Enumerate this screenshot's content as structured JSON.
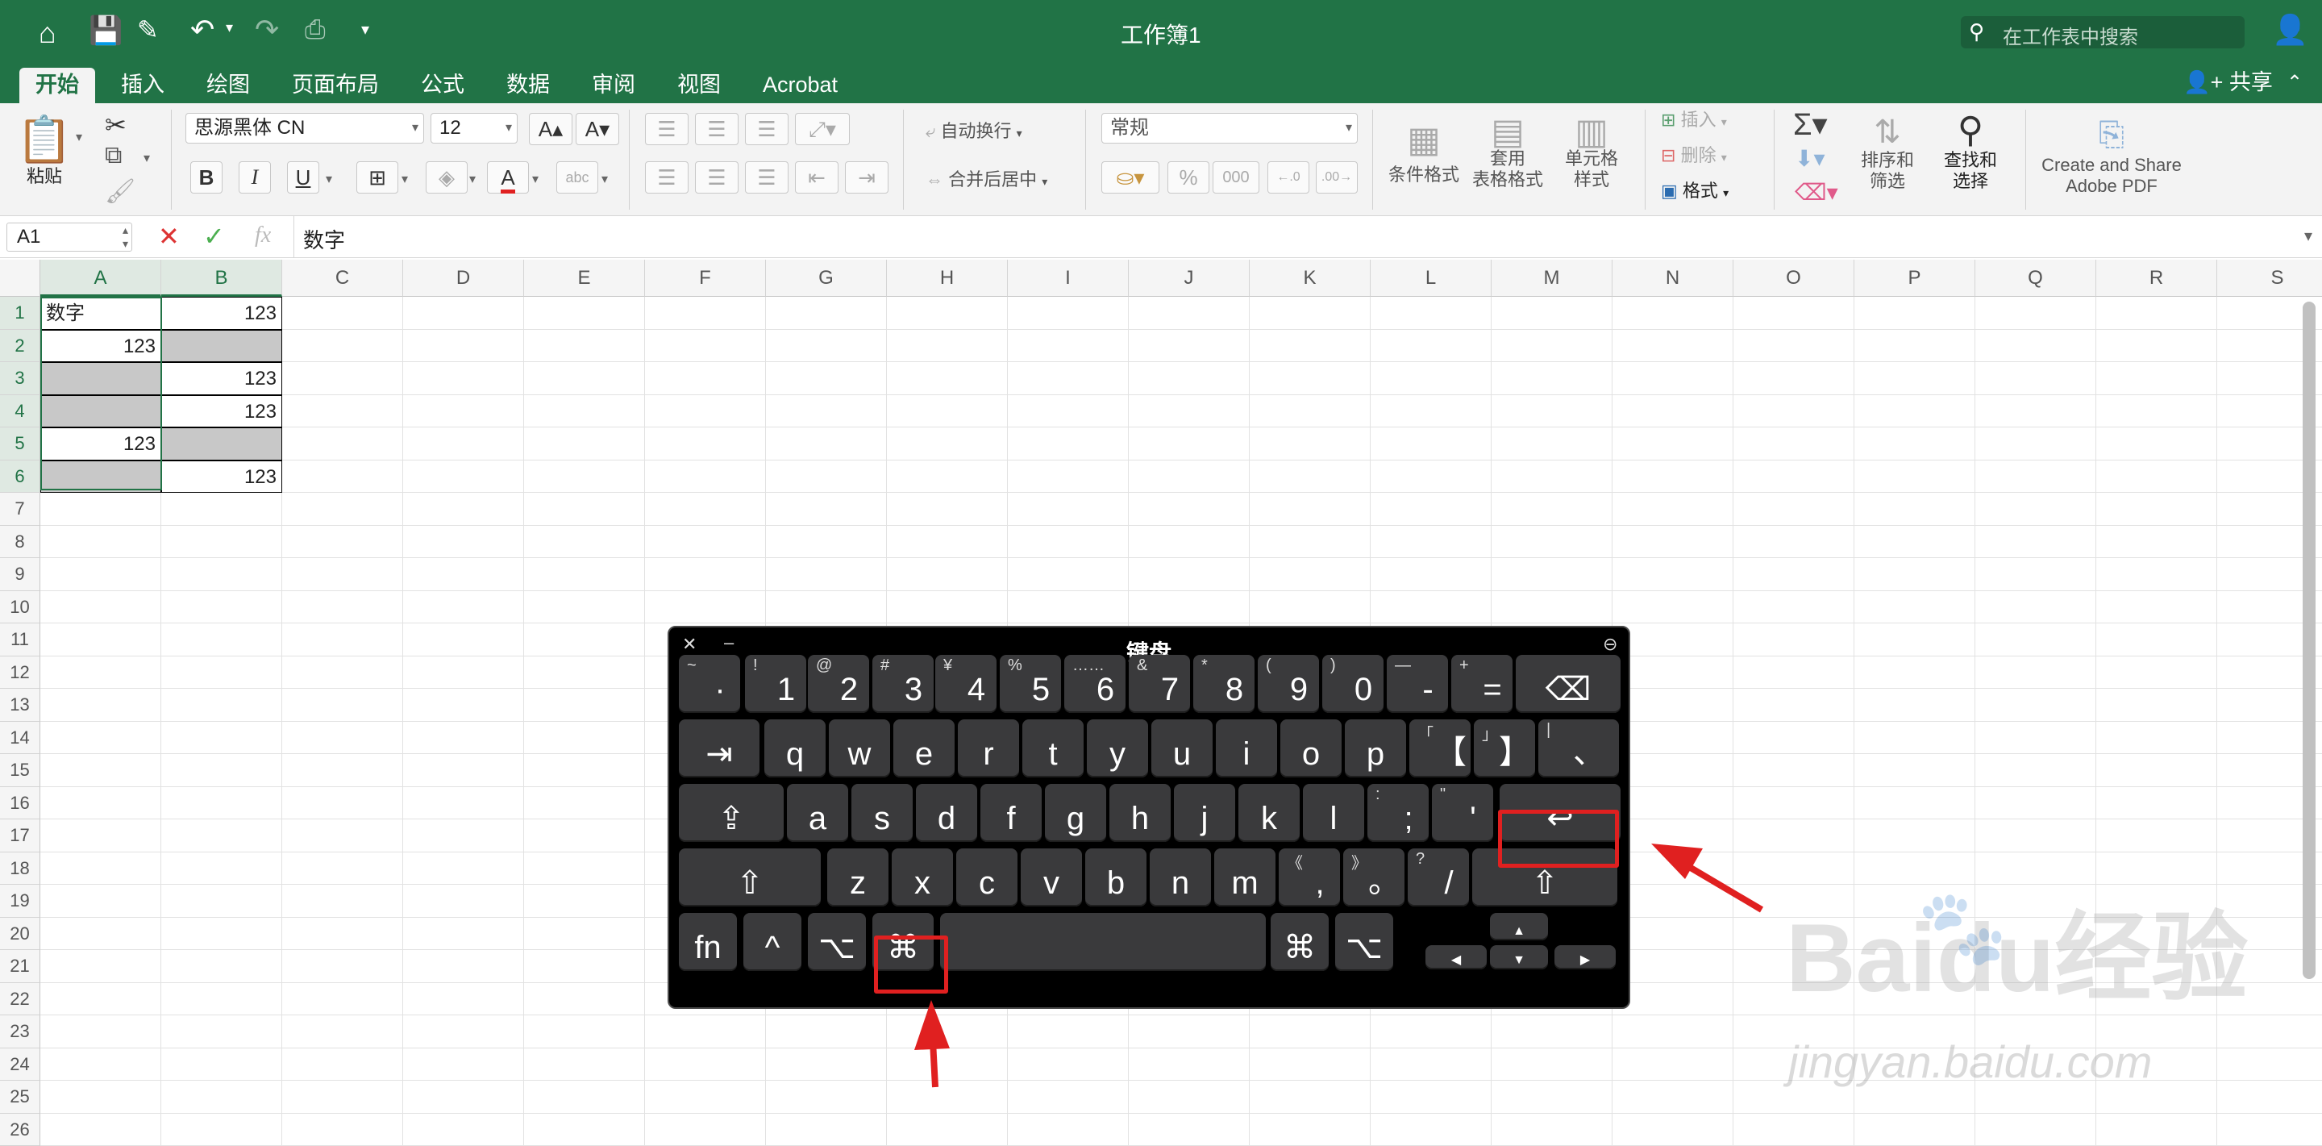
{
  "titlebar": {
    "workbook_title": "工作簿1",
    "search_placeholder": "在工作表中搜索"
  },
  "tabs": [
    {
      "label": "开始",
      "active": true
    },
    {
      "label": "插入"
    },
    {
      "label": "绘图"
    },
    {
      "label": "页面布局"
    },
    {
      "label": "公式"
    },
    {
      "label": "数据"
    },
    {
      "label": "审阅"
    },
    {
      "label": "视图"
    },
    {
      "label": "Acrobat"
    }
  ],
  "share_label": "共享",
  "ribbon": {
    "paste": "粘贴",
    "font_name": "思源黑体 CN",
    "font_size": "12",
    "wrap_text": "自动换行",
    "merge_center": "合并后居中",
    "number_format": "常规",
    "conditional_format": "条件格式",
    "table_format_1": "套用",
    "table_format_2": "表格格式",
    "cell_style_1": "单元格",
    "cell_style_2": "样式",
    "insert": "插入",
    "delete": "删除",
    "format": "格式",
    "sort_filter_1": "排序和",
    "sort_filter_2": "筛选",
    "find_select_1": "查找和",
    "find_select_2": "选择",
    "pdf_1": "Create and Share",
    "pdf_2": "Adobe PDF",
    "percent": "%",
    "thousands": "000"
  },
  "formula_bar": {
    "name_box": "A1",
    "fx": "fx",
    "content": "数字"
  },
  "columns": [
    "A",
    "B",
    "C",
    "D",
    "E",
    "F",
    "G",
    "H",
    "I",
    "J",
    "K",
    "L",
    "M",
    "N",
    "O",
    "P",
    "Q",
    "R",
    "S"
  ],
  "rows": [
    "1",
    "2",
    "3",
    "4",
    "5",
    "6",
    "7",
    "8",
    "9",
    "10",
    "11",
    "12",
    "13",
    "14",
    "15",
    "16",
    "17",
    "18",
    "19",
    "20",
    "21",
    "22",
    "23",
    "24",
    "25",
    "26"
  ],
  "cells": [
    {
      "a": "数字",
      "b": "123"
    },
    {
      "a": "123",
      "b": ""
    },
    {
      "a": "",
      "b": "123"
    },
    {
      "a": "",
      "b": "123"
    },
    {
      "a": "123",
      "b": ""
    },
    {
      "a": "",
      "b": "123"
    }
  ],
  "keyboard": {
    "title": "键盘",
    "rows": [
      [
        {
          "s": "~",
          "m": "·"
        },
        {
          "s": "!",
          "m": "1"
        },
        {
          "s": "@",
          "m": "2"
        },
        {
          "s": "#",
          "m": "3"
        },
        {
          "s": "¥",
          "m": "4"
        },
        {
          "s": "%",
          "m": "5"
        },
        {
          "s": "……",
          "m": "6"
        },
        {
          "s": "&",
          "m": "7"
        },
        {
          "s": "*",
          "m": "8"
        },
        {
          "s": "(",
          "m": "9"
        },
        {
          "s": ")",
          "m": "0"
        },
        {
          "s": "—",
          "m": "-"
        },
        {
          "s": "+",
          "m": "="
        },
        {
          "s": "",
          "m": "⌫"
        }
      ],
      [
        {
          "s": "",
          "m": "⇥"
        },
        {
          "s": "",
          "m": "q"
        },
        {
          "s": "",
          "m": "w"
        },
        {
          "s": "",
          "m": "e"
        },
        {
          "s": "",
          "m": "r"
        },
        {
          "s": "",
          "m": "t"
        },
        {
          "s": "",
          "m": "y"
        },
        {
          "s": "",
          "m": "u"
        },
        {
          "s": "",
          "m": "i"
        },
        {
          "s": "",
          "m": "o"
        },
        {
          "s": "",
          "m": "p"
        },
        {
          "s": "「",
          "m": "【"
        },
        {
          "s": "」",
          "m": "】"
        },
        {
          "s": "|",
          "m": "、"
        }
      ],
      [
        {
          "s": "",
          "m": "⇪"
        },
        {
          "s": "",
          "m": "a"
        },
        {
          "s": "",
          "m": "s"
        },
        {
          "s": "",
          "m": "d"
        },
        {
          "s": "",
          "m": "f"
        },
        {
          "s": "",
          "m": "g"
        },
        {
          "s": "",
          "m": "h"
        },
        {
          "s": "",
          "m": "j"
        },
        {
          "s": "",
          "m": "k"
        },
        {
          "s": "",
          "m": "l"
        },
        {
          "s": ":",
          "m": ";"
        },
        {
          "s": "\"",
          "m": "'"
        },
        {
          "s": "",
          "m": "↩"
        }
      ],
      [
        {
          "s": "",
          "m": "⇧"
        },
        {
          "s": "",
          "m": "z"
        },
        {
          "s": "",
          "m": "x"
        },
        {
          "s": "",
          "m": "c"
        },
        {
          "s": "",
          "m": "v"
        },
        {
          "s": "",
          "m": "b"
        },
        {
          "s": "",
          "m": "n"
        },
        {
          "s": "",
          "m": "m"
        },
        {
          "s": "《",
          "m": ","
        },
        {
          "s": "》",
          "m": "。"
        },
        {
          "s": "?",
          "m": "/"
        },
        {
          "s": "",
          "m": "⇧"
        }
      ],
      [
        {
          "s": "",
          "m": "fn"
        },
        {
          "s": "",
          "m": "^"
        },
        {
          "s": "",
          "m": "⌥"
        },
        {
          "s": "",
          "m": "⌘"
        },
        {
          "s": "",
          "m": ""
        },
        {
          "s": "",
          "m": "⌘"
        },
        {
          "s": "",
          "m": "⌥"
        },
        {
          "s": "",
          "m": "◀"
        },
        {
          "s": "",
          "m": "▲"
        },
        {
          "s": "",
          "m": "▼"
        },
        {
          "s": "",
          "m": "▶"
        }
      ]
    ]
  },
  "watermark": {
    "brand": "Baidu经验",
    "url": "jingyan.baidu.com"
  },
  "colors": {
    "excel_green": "#217346",
    "highlight": "#e02020"
  }
}
